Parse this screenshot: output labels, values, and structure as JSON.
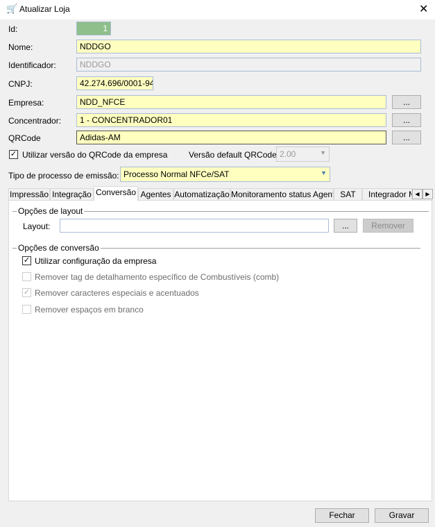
{
  "window": {
    "title": "Atualizar Loja"
  },
  "form": {
    "id_label": "Id:",
    "id_value": "1",
    "nome_label": "Nome:",
    "nome_value": "NDDGO",
    "identificador_label": "Identificador:",
    "identificador_value": "NDDGO",
    "cnpj_label": "CNPJ:",
    "cnpj_value": "42.274.696/0001-94",
    "empresa_label": "Empresa:",
    "empresa_value": "NDD_NFCE",
    "concentrador_label": "Concentrador:",
    "concentrador_value": "1 - CONCENTRADOR01",
    "qrcode_label": "QRCode",
    "qrcode_value": "Adidas-AM",
    "browse_label": "...",
    "usar_qrcode_label": "Utilizar versão do QRCode da empresa",
    "usar_qrcode_checked": true,
    "versao_label": "Versão default QRCode:",
    "versao_value": "2.00",
    "tipo_label": "Tipo de processo de emissão:",
    "tipo_value": "Processo Normal NFCe/SAT"
  },
  "tabs": [
    "Impressão",
    "Integração",
    "Conversão",
    "Agentes",
    "Automatização",
    "Monitoramento status Agente",
    "SAT",
    "Integrador MI"
  ],
  "active_tab": "Conversão",
  "conversao": {
    "layout_group": "Opções de layout",
    "layout_label": "Layout:",
    "layout_value": "",
    "browse_label": "...",
    "remover_label": "Remover",
    "conv_group": "Opções de conversão",
    "options": [
      {
        "label": "Utilizar configuração da empresa",
        "checked": true,
        "enabled": true
      },
      {
        "label": "Remover tag de detalhamento específico de Combustíveis (comb)",
        "checked": false,
        "enabled": false
      },
      {
        "label": "Remover caracteres especiais e acentuados",
        "checked": true,
        "enabled": false
      },
      {
        "label": "Remover espaços em branco",
        "checked": false,
        "enabled": false
      }
    ]
  },
  "footer": {
    "fechar": "Fechar",
    "gravar": "Gravar"
  }
}
